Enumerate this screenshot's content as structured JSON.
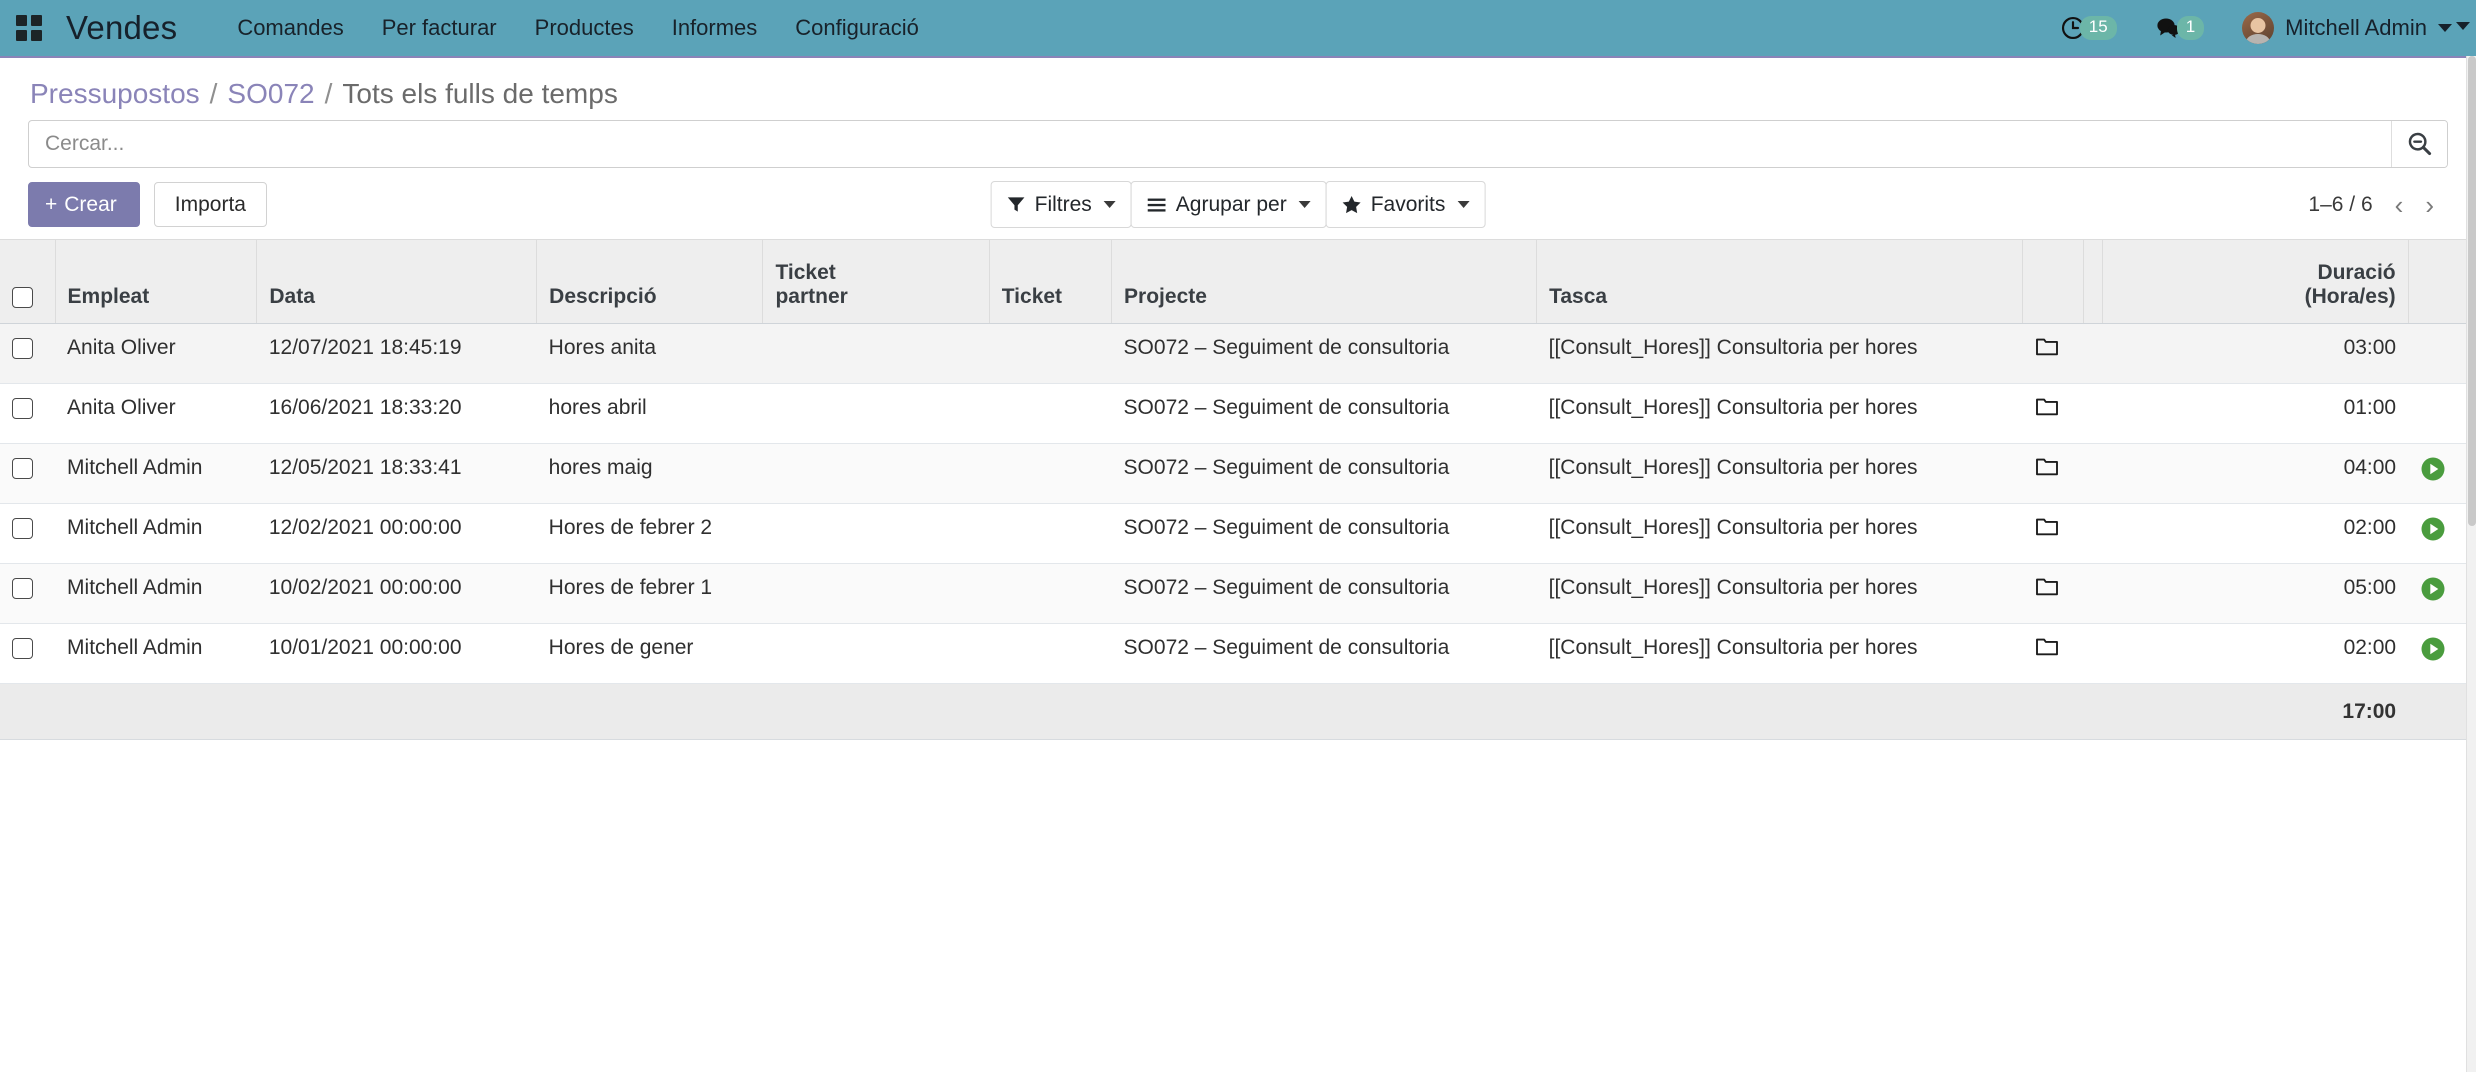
{
  "navbar": {
    "apps_icon": "apps-grid-icon",
    "brand": "Vendes",
    "menu": [
      {
        "label": "Comandes"
      },
      {
        "label": "Per facturar"
      },
      {
        "label": "Productes"
      },
      {
        "label": "Informes"
      },
      {
        "label": "Configuració"
      }
    ],
    "activities": {
      "icon": "clock-icon",
      "badge": "15"
    },
    "messages": {
      "icon": "chat-bubble-icon",
      "badge": "1"
    },
    "user": {
      "name": "Mitchell Admin",
      "avatar": "user-avatar",
      "caret": "chevron-down-icon"
    },
    "brand_color": "#5BA3B8",
    "accent_color": "#7C7BAD",
    "badge_color": "#6CB6A8"
  },
  "breadcrumb": {
    "root": "Pressupostos",
    "sep1": "/",
    "order": "SO072",
    "sep2": "/",
    "current": "Tots els fulls de temps"
  },
  "search": {
    "placeholder": "Cercar...",
    "value": "",
    "button_icon": "search-minus-icon"
  },
  "controls": {
    "create_label": "Crear",
    "create_plus": "+",
    "import_label": "Importa",
    "filters_label": "Filtres",
    "filters_icon": "funnel-icon",
    "groupby_label": "Agrupar per",
    "groupby_icon": "hamburger-icon",
    "favorites_label": "Favorits",
    "favorites_icon": "star-icon",
    "pager_count": "1–6 / 6",
    "pager_prev": "‹",
    "pager_next": "›"
  },
  "table": {
    "columns": [
      "Empleat",
      "Data",
      "Descripció",
      "Ticket partner",
      "Ticket",
      "Projecte",
      "Tasca",
      "",
      "Duració (Hora/es)",
      ""
    ],
    "duration_header_line1": "Duració",
    "duration_header_line2": "(Hora/es)",
    "ticket_partner_line1": "Ticket",
    "ticket_partner_line2": "partner",
    "rows": [
      {
        "empleat": "Anita Oliver",
        "data": "12/07/2021 18:45:19",
        "descripcio": "Hores anita",
        "ticket_partner": "",
        "ticket": "",
        "projecte": "SO072 – Seguiment de consultoria",
        "tasca": "[[Consult_Hores]] Consultoria per hores",
        "folder_icon": "folder-icon",
        "duracio": "03:00",
        "play": false
      },
      {
        "empleat": "Anita Oliver",
        "data": "16/06/2021 18:33:20",
        "descripcio": "hores abril",
        "ticket_partner": "",
        "ticket": "",
        "projecte": "SO072 – Seguiment de consultoria",
        "tasca": "[[Consult_Hores]] Consultoria per hores",
        "folder_icon": "folder-icon",
        "duracio": "01:00",
        "play": false
      },
      {
        "empleat": "Mitchell Admin",
        "data": "12/05/2021 18:33:41",
        "descripcio": "hores maig",
        "ticket_partner": "",
        "ticket": "",
        "projecte": "SO072 – Seguiment de consultoria",
        "tasca": "[[Consult_Hores]] Consultoria per hores",
        "folder_icon": "folder-icon",
        "duracio": "04:00",
        "play": true
      },
      {
        "empleat": "Mitchell Admin",
        "data": "12/02/2021 00:00:00",
        "descripcio": "Hores de febrer 2",
        "ticket_partner": "",
        "ticket": "",
        "projecte": "SO072 – Seguiment de consultoria",
        "tasca": "[[Consult_Hores]] Consultoria per hores",
        "folder_icon": "folder-icon",
        "duracio": "02:00",
        "play": true
      },
      {
        "empleat": "Mitchell Admin",
        "data": "10/02/2021 00:00:00",
        "descripcio": "Hores de febrer 1",
        "ticket_partner": "",
        "ticket": "",
        "projecte": "SO072 – Seguiment de consultoria",
        "tasca": "[[Consult_Hores]] Consultoria per hores",
        "folder_icon": "folder-icon",
        "duracio": "05:00",
        "play": true
      },
      {
        "empleat": "Mitchell Admin",
        "data": "10/01/2021 00:00:00",
        "descripcio": "Hores de gener",
        "ticket_partner": "",
        "ticket": "",
        "projecte": "SO072 – Seguiment de consultoria",
        "tasca": "[[Consult_Hores]] Consultoria per hores",
        "folder_icon": "folder-icon",
        "duracio": "02:00",
        "play": true
      }
    ],
    "total_duration": "17:00"
  }
}
